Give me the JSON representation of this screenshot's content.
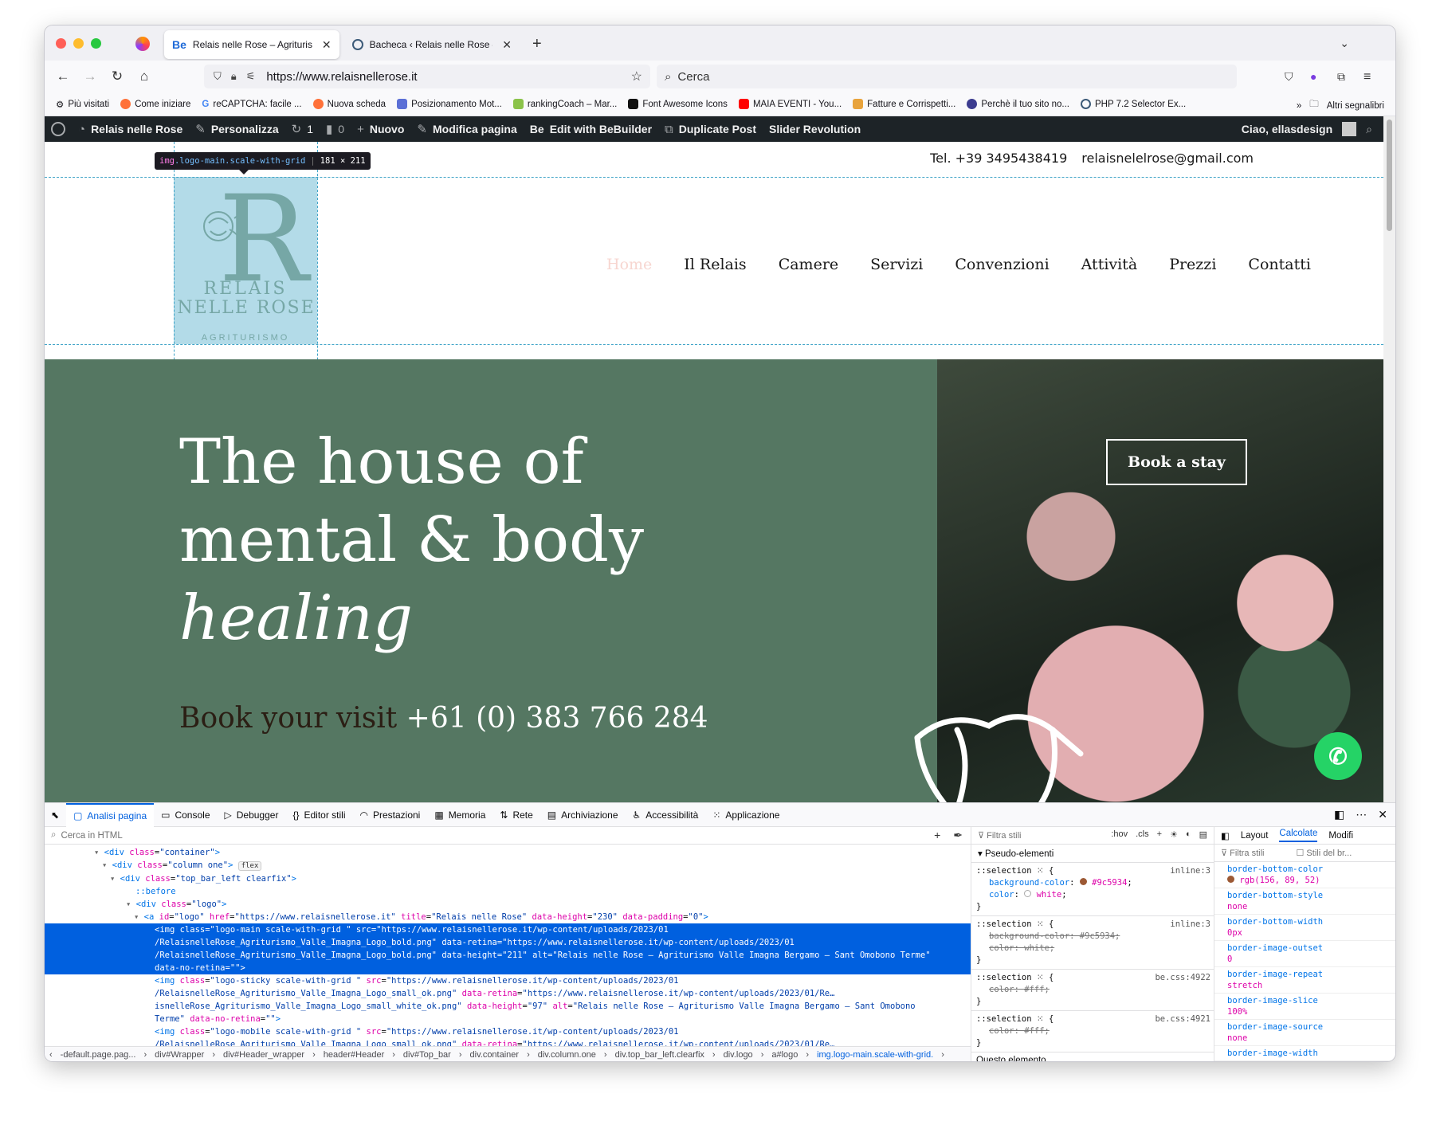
{
  "browser": {
    "tabs": [
      {
        "icon": "Be",
        "title": "Relais nelle Rose – Agriturismo V",
        "active": true
      },
      {
        "icon": "wp",
        "title": "Bacheca ‹ Relais nelle Rose — W",
        "active": false
      }
    ],
    "url": "https://www.relaisnellerose.it",
    "search_placeholder": "Cerca",
    "bookmarks": [
      "Più visitati",
      "Come iniziare",
      "reCAPTCHA: facile ...",
      "Nuova scheda",
      "Posizionamento Mot...",
      "rankingCoach – Mar...",
      "Font Awesome Icons",
      "MAIA EVENTI - You...",
      "Fatture e Corrispetti...",
      "Perchè il tuo sito no...",
      "PHP 7.2 Selector Ex..."
    ],
    "bookmarks_more": "Altri segnalibri"
  },
  "wpbar": {
    "site": "Relais nelle Rose",
    "customize": "Personalizza",
    "updates": "1",
    "comments": "0",
    "new": "Nuovo",
    "edit": "Modifica pagina",
    "bebuilder": "Edit with BeBuilder",
    "duplicate": "Duplicate Post",
    "slider": "Slider Revolution",
    "greeting": "Ciao, ellasdesign"
  },
  "site": {
    "phone": "Tel. +39 3495438419",
    "email": "relaisnelelrose@gmail.com",
    "logo": {
      "line1": "RELAIS",
      "line2": "NELLE ROSE",
      "line3": "AGRITURISMO"
    },
    "tooltip": {
      "tag": "img",
      "cls": ".logo-main.scale-with-grid",
      "size": "181 × 211"
    },
    "menu": [
      "Home",
      "Il Relais",
      "Camere",
      "Servizi",
      "Convenzioni",
      "Attività",
      "Prezzi",
      "Contatti"
    ],
    "hero": {
      "line1": "The house of",
      "line2": "mental & body",
      "line3": "healing",
      "visit_label": "Book your visit",
      "visit_number": "+61 (0) 383 766 284",
      "book_button": "Book a stay"
    }
  },
  "devtools": {
    "tabs": [
      "Analisi pagina",
      "Console",
      "Debugger",
      "Editor stili",
      "Prestazioni",
      "Memoria",
      "Rete",
      "Archiviazione",
      "Accessibilità",
      "Applicazione"
    ],
    "search_placeholder": "Cerca in HTML",
    "breadcrumbs": [
      "-default.page.pag...",
      "div#Wrapper",
      "div#Header_wrapper",
      "header#Header",
      "div#Top_bar",
      "div.container",
      "div.column.one",
      "div.top_bar_left.clearfix",
      "div.logo",
      "a#logo",
      "img.logo-main.scale-with-grid."
    ],
    "rules_filter": "Filtra stili",
    "rules_tools": [
      ":hov",
      ".cls"
    ],
    "pseudo_label": "Pseudo-elementi",
    "questo": "Questo elemento",
    "computed_tabs": [
      "Layout",
      "Calcolate",
      "Modifi"
    ],
    "computed_filter": "Filtra stili",
    "computed_browser": "Stili del br...",
    "computed": [
      {
        "name": "border-bottom-color",
        "value": "rgb(156, 89, 52)"
      },
      {
        "name": "border-bottom-style",
        "value": "none"
      },
      {
        "name": "border-bottom-width",
        "value": "0px"
      },
      {
        "name": "border-image-outset",
        "value": "0"
      },
      {
        "name": "border-image-repeat",
        "value": "stretch"
      },
      {
        "name": "border-image-slice",
        "value": "100%"
      },
      {
        "name": "border-image-source",
        "value": "none"
      },
      {
        "name": "border-image-width",
        "value": ""
      }
    ]
  }
}
